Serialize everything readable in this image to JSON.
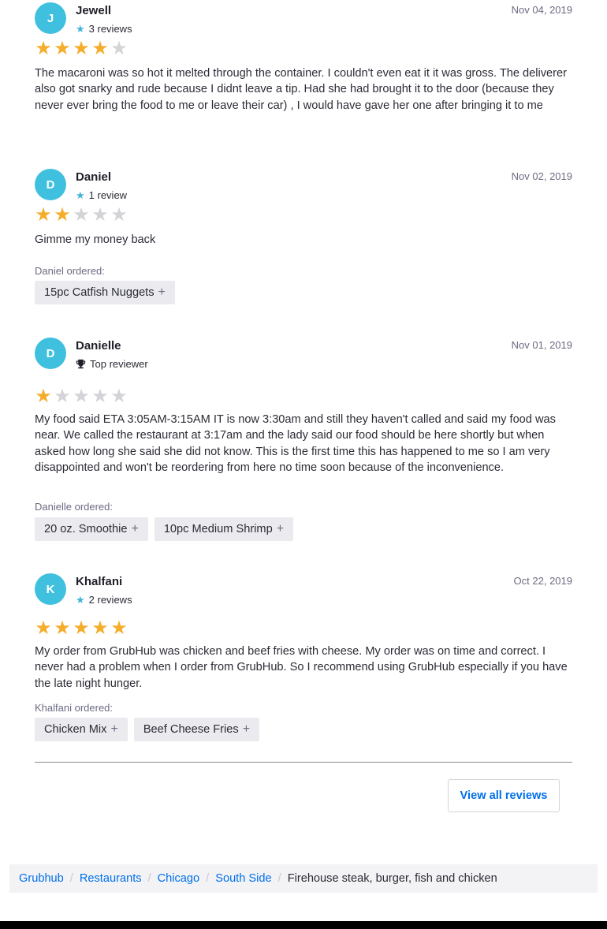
{
  "reviews": [
    {
      "initial": "J",
      "name": "Jewell",
      "meta_type": "reviews",
      "meta_text": "3 reviews",
      "date": "Nov 04, 2019",
      "rating": 4,
      "text": "The macaroni was so hot it melted through the container. I couldn't even eat it it was gross. The deliverer also got snarky and rude because I didnt leave a tip. Had she had brought it to the door (because they never ever bring the food to me or leave their car) , I would have gave her one after bringing it to me",
      "ordered_label": "",
      "items": []
    },
    {
      "initial": "D",
      "name": "Daniel",
      "meta_type": "reviews",
      "meta_text": "1 review",
      "date": "Nov 02, 2019",
      "rating": 2,
      "text": "Gimme my money back",
      "ordered_label": "Daniel ordered:",
      "items": [
        "15pc Catfish Nuggets"
      ]
    },
    {
      "initial": "D",
      "name": "Danielle",
      "meta_type": "top",
      "meta_text": "Top reviewer",
      "date": "Nov 01, 2019",
      "rating": 1,
      "text": "My food said ETA 3:05AM-3:15AM IT is now 3:30am and still they haven't called and said my food was near. We called the restaurant at 3:17am and the lady said our food should be here shortly but when asked how long she said she did not know. This is the first time this has happened to me so I am very disappointed and won't be reordering from here no time soon because of the inconvenience.",
      "ordered_label": "Danielle ordered:",
      "items": [
        "20 oz. Smoothie",
        "10pc Medium Shrimp"
      ]
    },
    {
      "initial": "K",
      "name": "Khalfani",
      "meta_type": "reviews",
      "meta_text": "2 reviews",
      "date": "Oct 22, 2019",
      "rating": 5,
      "text": "My order from GrubHub was chicken and beef fries with cheese. My order was on time and correct. I never had a problem when I order from GrubHub. So I recommend using GrubHub especially if you have the late night hunger.",
      "ordered_label": "Khalfani ordered:",
      "items": [
        "Chicken Mix",
        "Beef Cheese Fries"
      ]
    }
  ],
  "view_all_label": "View all reviews",
  "breadcrumb": {
    "links": [
      "Grubhub",
      "Restaurants",
      "Chicago",
      "South Side"
    ],
    "current": "Firehouse steak, burger, fish and chicken"
  },
  "icons": {
    "reviewer_star": "star-icon",
    "top_reviewer": "trophy-icon",
    "add_item": "plus-icon"
  },
  "colors": {
    "avatar": "#3fc0de",
    "star_filled": "#f5ad2c",
    "star_empty": "#d4d4d8",
    "link": "#0070eb"
  },
  "rating_max": 5
}
